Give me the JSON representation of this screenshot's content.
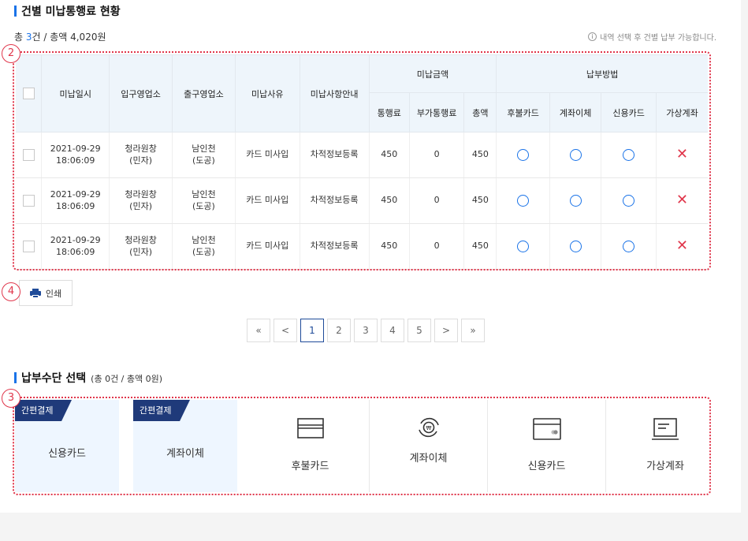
{
  "section1": {
    "title": "건별 미납통행료 현황"
  },
  "summary": {
    "prefix": "총 ",
    "count": "3",
    "suffix": "건 / 총액 4,020원"
  },
  "notice": {
    "icon": "info-icon",
    "text": "내역 선택 후 건별 납부 가능합니다."
  },
  "markers": {
    "m2": "2",
    "m3": "3",
    "m4": "4"
  },
  "table": {
    "headers": {
      "date": "미납일시",
      "entry": "입구영업소",
      "exit": "출구영업소",
      "reason": "미납사유",
      "guide": "미납사항안내",
      "amount_group": "미납금액",
      "method_group": "납부방법",
      "toll": "통행료",
      "extra": "부가통행료",
      "total": "총액",
      "postpaid": "후불카드",
      "transfer": "계좌이체",
      "credit": "신용카드",
      "virtual": "가상계좌"
    },
    "rows": [
      {
        "date": "2021-09-29",
        "time": "18:06:09",
        "entry": "청라원창",
        "entry_type": "(민자)",
        "exit": "남인천",
        "exit_type": "(도공)",
        "reason": "카드 미사입",
        "guide": "차적정보등록",
        "toll": "450",
        "extra": "0",
        "total": "450",
        "postpaid": "O",
        "transfer": "O",
        "credit": "O",
        "virtual": "X"
      },
      {
        "date": "2021-09-29",
        "time": "18:06:09",
        "entry": "청라원창",
        "entry_type": "(민자)",
        "exit": "남인천",
        "exit_type": "(도공)",
        "reason": "카드 미사입",
        "guide": "차적정보등록",
        "toll": "450",
        "extra": "0",
        "total": "450",
        "postpaid": "O",
        "transfer": "O",
        "credit": "O",
        "virtual": "X"
      },
      {
        "date": "2021-09-29",
        "time": "18:06:09",
        "entry": "청라원창",
        "entry_type": "(민자)",
        "exit": "남인천",
        "exit_type": "(도공)",
        "reason": "카드 미사입",
        "guide": "차적정보등록",
        "toll": "450",
        "extra": "0",
        "total": "450",
        "postpaid": "O",
        "transfer": "O",
        "credit": "O",
        "virtual": "X"
      }
    ]
  },
  "print": {
    "label": "인쇄"
  },
  "pager": {
    "first": "«",
    "prev": "<",
    "pages": [
      "1",
      "2",
      "3",
      "4",
      "5"
    ],
    "next": ">",
    "last": "»",
    "current": "1"
  },
  "section2": {
    "title": "납부수단 선택",
    "sub": "(총 0건 / 총액 0원)"
  },
  "pay": {
    "simple": [
      {
        "tag": "간편결제",
        "label": "신용카드"
      },
      {
        "tag": "간편결제",
        "label": "계좌이체"
      }
    ],
    "methods": [
      {
        "icon": "card-icon",
        "label": "후불카드"
      },
      {
        "icon": "transfer-icon",
        "label": "계좌이체"
      },
      {
        "icon": "credit-card-icon",
        "label": "신용카드"
      },
      {
        "icon": "virtual-account-icon",
        "label": "가상계좌"
      }
    ]
  },
  "colors": {
    "accent": "#1a73e8",
    "navy": "#1f3a7a",
    "marker": "#e0364b"
  }
}
